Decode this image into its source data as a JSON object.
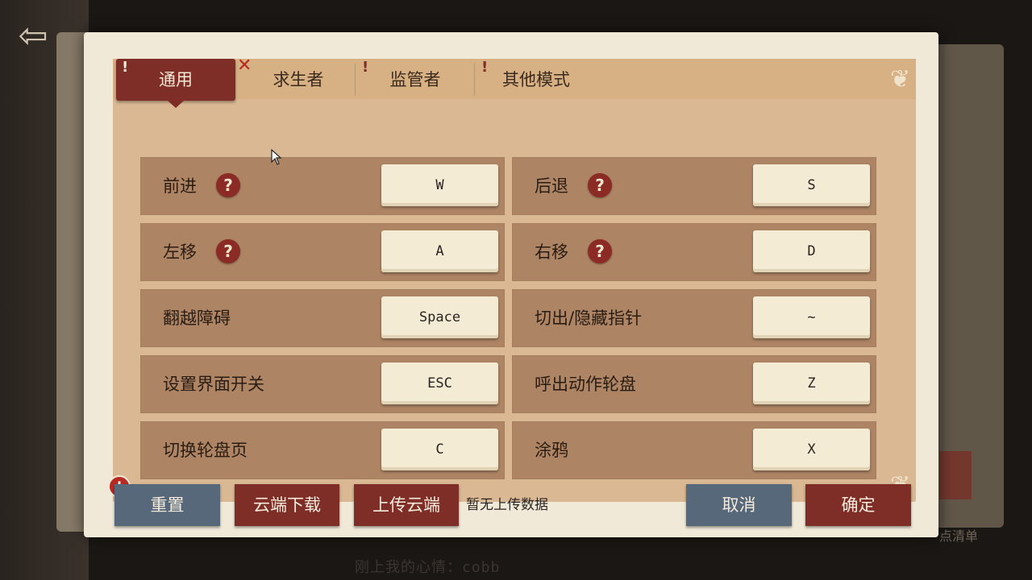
{
  "tabs": [
    {
      "label": "通用",
      "active": true
    },
    {
      "label": "求生者",
      "active": false
    },
    {
      "label": "监管者",
      "active": false
    },
    {
      "label": "其他模式",
      "active": false
    }
  ],
  "bindings_left": [
    {
      "action": "前进",
      "key": "W",
      "help": true
    },
    {
      "action": "左移",
      "key": "A",
      "help": true
    },
    {
      "action": "翻越障碍",
      "key": "Space",
      "help": false
    },
    {
      "action": "设置界面开关",
      "key": "ESC",
      "help": false
    },
    {
      "action": "切换轮盘页",
      "key": "C",
      "help": false
    }
  ],
  "bindings_right": [
    {
      "action": "后退",
      "key": "S",
      "help": true
    },
    {
      "action": "右移",
      "key": "D",
      "help": true
    },
    {
      "action": "切出/隐藏指针",
      "key": "~",
      "help": false
    },
    {
      "action": "呼出动作轮盘",
      "key": "Z",
      "help": false
    },
    {
      "action": "涂鸦",
      "key": "X",
      "help": false
    }
  ],
  "footer": {
    "reset_label": "重置",
    "cloud_download_label": "云端下载",
    "upload_cloud_label": "上传云端",
    "status_text": "暂无上传数据",
    "cancel_label": "取消",
    "confirm_label": "确定"
  },
  "background": {
    "bottom_hint": "刚上我的心情：cobb",
    "right_hint": "点清单"
  },
  "icons": {
    "help": "question-icon",
    "back": "back-arrow-icon",
    "alert": "exclamation-icon",
    "close": "x-icon"
  },
  "colors": {
    "accent_red": "#7e2d27",
    "button_blue": "#57687a",
    "panel": "#d9b893",
    "row": "#ae8564",
    "key": "#f4ebd5"
  }
}
